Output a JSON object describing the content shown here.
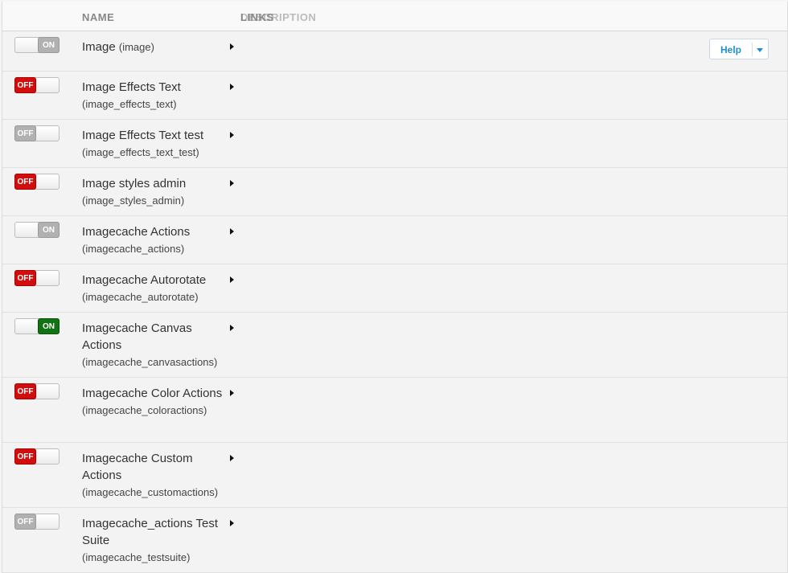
{
  "header": {
    "col_name": "NAME",
    "col_links": "LINKS",
    "col_description": "DESCRIPTION"
  },
  "help": {
    "label": "Help"
  },
  "colors": {
    "off": "#d10d0d",
    "disabled": "#b1b1b1",
    "on": "#127312",
    "help": "#1f8fd4"
  },
  "modules": [
    {
      "title": "Image",
      "machine": "(image)",
      "state": "ON",
      "style": "disabled",
      "inline": true
    },
    {
      "title": "Image Effects Text",
      "machine": "(image_effects_text)",
      "state": "OFF",
      "style": "off"
    },
    {
      "title": "Image Effects Text test",
      "machine": "(image_effects_text_test)",
      "state": "OFF",
      "style": "disabled"
    },
    {
      "title": "Image styles admin",
      "machine": "(image_styles_admin)",
      "state": "OFF",
      "style": "off"
    },
    {
      "title": "Imagecache Actions",
      "machine": "(imagecache_actions)",
      "state": "ON",
      "style": "disabled"
    },
    {
      "title": "Imagecache Autorotate",
      "machine": "(imagecache_autorotate)",
      "state": "OFF",
      "style": "off"
    },
    {
      "title": "Imagecache Canvas Actions",
      "machine": "(imagecache_canvasactions)",
      "state": "ON",
      "style": "on"
    },
    {
      "title": "Imagecache Color Actions",
      "machine": "(imagecache_coloractions)",
      "state": "OFF",
      "style": "off"
    },
    {
      "title": "Imagecache Custom Actions",
      "machine": "(imagecache_customactions)",
      "state": "OFF",
      "style": "off"
    },
    {
      "title": "Imagecache_actions Test Suite",
      "machine": "(imagecache_testsuite)",
      "state": "OFF",
      "style": "disabled"
    }
  ]
}
